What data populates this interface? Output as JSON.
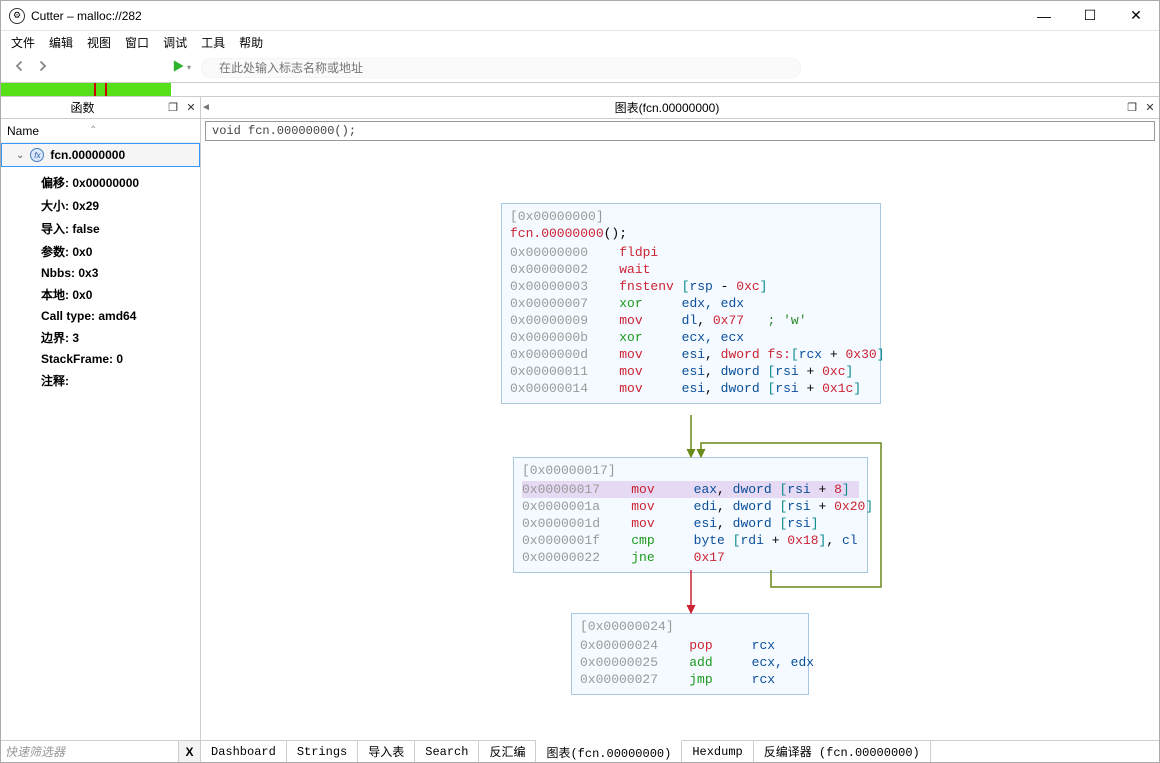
{
  "window": {
    "title": "Cutter – malloc://282"
  },
  "menu": [
    "文件",
    "编辑",
    "视图",
    "窗口",
    "调试",
    "工具",
    "帮助"
  ],
  "toolbar": {
    "cmd_placeholder": "在此处输入标志名称或地址"
  },
  "left": {
    "panel_title": "函数",
    "tree_header": "Name",
    "fn_name": "fcn.00000000",
    "props": [
      {
        "k": "偏移:",
        "v": "0x00000000"
      },
      {
        "k": "大小:",
        "v": "0x29"
      },
      {
        "k": "导入:",
        "v": "false"
      },
      {
        "k": "参数:",
        "v": "0x0"
      },
      {
        "k": "Nbbs:",
        "v": "0x3"
      },
      {
        "k": "本地:",
        "v": "0x0"
      },
      {
        "k": "Call type:",
        "v": "amd64"
      },
      {
        "k": "边界:",
        "v": "3"
      },
      {
        "k": "StackFrame:",
        "v": "0"
      },
      {
        "k": "注释:",
        "v": ""
      }
    ],
    "quick_placeholder": "快速筛选器",
    "clear_btn": "X"
  },
  "right": {
    "tab_title": "图表(fcn.00000000)",
    "signature": "void fcn.00000000();"
  },
  "blocks": {
    "b1": {
      "addr": "[0x00000000]",
      "fncall": "fcn.00000000();",
      "rows": [
        [
          "0x00000000",
          "fldpi",
          "",
          "red",
          ""
        ],
        [
          "0x00000002",
          "wait",
          "",
          "red",
          ""
        ],
        [
          "0x00000003",
          "fnstenv",
          "[rsp - 0xc]",
          "red",
          "bracket"
        ],
        [
          "0x00000007",
          "xor",
          "edx, edx",
          "green",
          "blue"
        ],
        [
          "0x00000009",
          "mov",
          "dl, 0x77",
          "red",
          "bluered",
          "; 'w'"
        ],
        [
          "0x0000000b",
          "xor",
          "ecx, ecx",
          "green",
          "blue"
        ],
        [
          "0x0000000d",
          "mov",
          "esi, dword fs:[rcx + 0x30]",
          "red",
          "fsrow"
        ],
        [
          "0x00000011",
          "mov",
          "esi, dword [rsi + 0xc]",
          "red",
          "blue_bracket"
        ],
        [
          "0x00000014",
          "mov",
          "esi, dword [rsi + 0x1c]",
          "red",
          "blue_bracket"
        ]
      ]
    },
    "b2": {
      "addr": "[0x00000017]",
      "rows": [
        [
          "0x00000017",
          "mov",
          "eax, dword [rsi + 8]",
          "red",
          "sel"
        ],
        [
          "0x0000001a",
          "mov",
          "edi, dword [rsi + 0x20]",
          "red",
          "blue_bracket"
        ],
        [
          "0x0000001d",
          "mov",
          "esi, dword [rsi]",
          "red",
          "blue_plain"
        ],
        [
          "0x0000001f",
          "cmp",
          "byte [rdi + 0x18], cl",
          "green",
          "cmp"
        ],
        [
          "0x00000022",
          "jne",
          "0x17",
          "green",
          "red"
        ]
      ]
    },
    "b3": {
      "addr": "[0x00000024]",
      "rows": [
        [
          "0x00000024",
          "pop",
          "rcx",
          "red",
          "blue"
        ],
        [
          "0x00000025",
          "add",
          "ecx, edx",
          "green",
          "blue"
        ],
        [
          "0x00000027",
          "jmp",
          "rcx",
          "green",
          "blue"
        ]
      ]
    }
  },
  "bottom_tabs": [
    "Dashboard",
    "Strings",
    "导入表",
    "Search",
    "反汇编",
    "图表(fcn.00000000)",
    "Hexdump",
    "反编译器 (fcn.00000000)"
  ],
  "active_bottom_tab": 5
}
